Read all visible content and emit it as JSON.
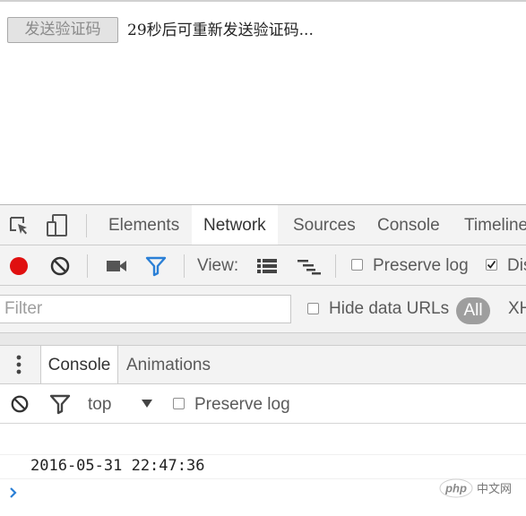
{
  "webpage": {
    "send_code_button": "发送验证码",
    "countdown_text": "29秒后可重新发送验证码..."
  },
  "devtools": {
    "tabs": [
      {
        "label": "Elements",
        "active": false
      },
      {
        "label": "Network",
        "active": true
      },
      {
        "label": "Sources",
        "active": false
      },
      {
        "label": "Console",
        "active": false
      },
      {
        "label": "Timeline",
        "active": false
      }
    ],
    "network_toolbar": {
      "view_label": "View:",
      "preserve_log_label": "Preserve log",
      "preserve_log_checked": false,
      "disable_cache_label": "Dis",
      "disable_cache_checked": true
    },
    "filter_bar": {
      "filter_placeholder": "Filter",
      "filter_value": "",
      "hide_data_urls_label": "Hide data URLs",
      "hide_data_urls_checked": false,
      "all_label": "All",
      "xhr_label": "XH"
    },
    "drawer_tabs": [
      {
        "label": "Console",
        "active": true
      },
      {
        "label": "Animations",
        "active": false
      }
    ],
    "console_toolbar": {
      "context": "top",
      "preserve_log_label": "Preserve log",
      "preserve_log_checked": false
    },
    "console_output": {
      "lines": [
        "2016-05-31 22:47:36"
      ]
    }
  },
  "watermark": {
    "brand": "php",
    "suffix": "中文网"
  },
  "colors": {
    "accent_blue": "#3879d9",
    "record_red": "#e01010",
    "filter_blue": "#2a7fd6"
  }
}
